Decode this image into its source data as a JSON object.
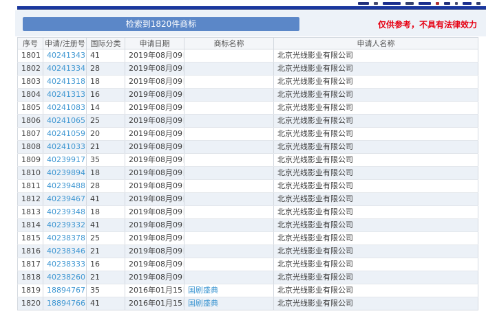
{
  "results_bar": {
    "label": "检索到1820件商标"
  },
  "disclaimer": "仅供参考，不具有法律效力",
  "colors": {
    "top_bar_navy": "#1a379e",
    "results_bar_blue": "#5b87c8",
    "disclaimer_red": "#e60012",
    "link_blue": "#3f97d2",
    "row_stripe": "#ecf1f7",
    "header_bg": "#f4f6f9"
  },
  "table": {
    "columns": [
      "序号",
      "申请/注册号",
      "国际分类",
      "申请日期",
      "商标名称",
      "申请人名称"
    ],
    "rows": [
      {
        "seq": "1801",
        "reg_no": "40241343",
        "intl_class": "41",
        "date": "2019年08月09日",
        "name": "",
        "applicant": "北京光线影业有限公司"
      },
      {
        "seq": "1802",
        "reg_no": "40241334",
        "intl_class": "28",
        "date": "2019年08月09日",
        "name": "",
        "applicant": "北京光线影业有限公司"
      },
      {
        "seq": "1803",
        "reg_no": "40241318",
        "intl_class": "18",
        "date": "2019年08月09日",
        "name": "",
        "applicant": "北京光线影业有限公司"
      },
      {
        "seq": "1804",
        "reg_no": "40241313",
        "intl_class": "16",
        "date": "2019年08月09日",
        "name": "",
        "applicant": "北京光线影业有限公司"
      },
      {
        "seq": "1805",
        "reg_no": "40241083",
        "intl_class": "14",
        "date": "2019年08月09日",
        "name": "",
        "applicant": "北京光线影业有限公司"
      },
      {
        "seq": "1806",
        "reg_no": "40241065",
        "intl_class": "25",
        "date": "2019年08月09日",
        "name": "",
        "applicant": "北京光线影业有限公司"
      },
      {
        "seq": "1807",
        "reg_no": "40241059",
        "intl_class": "20",
        "date": "2019年08月09日",
        "name": "",
        "applicant": "北京光线影业有限公司"
      },
      {
        "seq": "1808",
        "reg_no": "40241033",
        "intl_class": "21",
        "date": "2019年08月09日",
        "name": "",
        "applicant": "北京光线影业有限公司"
      },
      {
        "seq": "1809",
        "reg_no": "40239917",
        "intl_class": "35",
        "date": "2019年08月09日",
        "name": "",
        "applicant": "北京光线影业有限公司"
      },
      {
        "seq": "1810",
        "reg_no": "40239894",
        "intl_class": "18",
        "date": "2019年08月09日",
        "name": "",
        "applicant": "北京光线影业有限公司"
      },
      {
        "seq": "1811",
        "reg_no": "40239488",
        "intl_class": "28",
        "date": "2019年08月09日",
        "name": "",
        "applicant": "北京光线影业有限公司"
      },
      {
        "seq": "1812",
        "reg_no": "40239467",
        "intl_class": "41",
        "date": "2019年08月09日",
        "name": "",
        "applicant": "北京光线影业有限公司"
      },
      {
        "seq": "1813",
        "reg_no": "40239348",
        "intl_class": "18",
        "date": "2019年08月09日",
        "name": "",
        "applicant": "北京光线影业有限公司"
      },
      {
        "seq": "1814",
        "reg_no": "40239332",
        "intl_class": "41",
        "date": "2019年08月09日",
        "name": "",
        "applicant": "北京光线影业有限公司"
      },
      {
        "seq": "1815",
        "reg_no": "40238378",
        "intl_class": "25",
        "date": "2019年08月09日",
        "name": "",
        "applicant": "北京光线影业有限公司"
      },
      {
        "seq": "1816",
        "reg_no": "40238346",
        "intl_class": "21",
        "date": "2019年08月09日",
        "name": "",
        "applicant": "北京光线影业有限公司"
      },
      {
        "seq": "1817",
        "reg_no": "40238333",
        "intl_class": "16",
        "date": "2019年08月09日",
        "name": "",
        "applicant": "北京光线影业有限公司"
      },
      {
        "seq": "1818",
        "reg_no": "40238260",
        "intl_class": "21",
        "date": "2019年08月09日",
        "name": "",
        "applicant": "北京光线影业有限公司"
      },
      {
        "seq": "1819",
        "reg_no": "18894767",
        "intl_class": "35",
        "date": "2016年01月15日",
        "name": "国剧盛典",
        "applicant": "北京光线影业有限公司"
      },
      {
        "seq": "1820",
        "reg_no": "18894766",
        "intl_class": "41",
        "date": "2016年01月15日",
        "name": "国剧盛典",
        "applicant": "北京光线影业有限公司"
      }
    ]
  }
}
